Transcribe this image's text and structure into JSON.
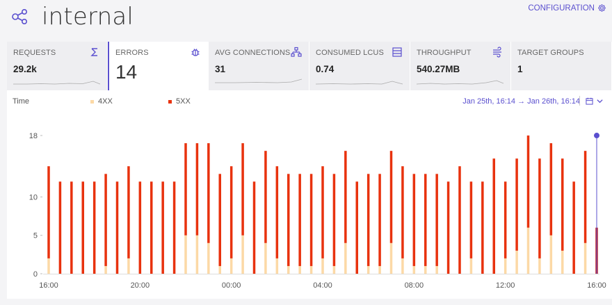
{
  "header": {
    "title": "internal",
    "config_label": "CONFIGURATION"
  },
  "tabs": [
    {
      "label": "REQUESTS",
      "value": "29.2k",
      "icon": "sigma-icon"
    },
    {
      "label": "ERRORS",
      "value": "14",
      "icon": "bug-icon",
      "active": true
    },
    {
      "label": "AVG CONNECTIONS",
      "value": "31",
      "icon": "network-icon"
    },
    {
      "label": "CONSUMED LCUS",
      "value": "0.74",
      "icon": "server-icon"
    },
    {
      "label": "THROUGHPUT",
      "value": "540.27MB",
      "icon": "stream-icon"
    },
    {
      "label": "TARGET GROUPS",
      "value": "1"
    }
  ],
  "panel": {
    "time_label": "Time",
    "legend": [
      {
        "name": "4XX",
        "color": "#fcd9a6"
      },
      {
        "name": "5XX",
        "color": "#e8320e"
      }
    ],
    "date_range": "Jan 25th, 16:14 → Jan 26th, 16:14"
  },
  "colors": {
    "accent": "#5a4fcf",
    "series_4xx": "#fcd9a6",
    "series_5xx": "#e8320e"
  },
  "chart_data": {
    "type": "bar",
    "stacked": true,
    "x_tick_labels": [
      "16:00",
      "20:00",
      "00:00",
      "04:00",
      "08:00",
      "12:00",
      "16:00"
    ],
    "y_ticks": [
      0,
      5,
      10,
      18
    ],
    "ylim": [
      0,
      19
    ],
    "grid": false,
    "legend_position": "top-left",
    "x_hours": [
      16.0,
      16.5,
      17.0,
      17.5,
      18.0,
      18.5,
      19.0,
      19.5,
      20.0,
      20.5,
      21.0,
      21.5,
      22.0,
      22.5,
      23.0,
      23.5,
      24.0,
      24.5,
      25.0,
      25.5,
      26.0,
      26.5,
      27.0,
      27.5,
      28.0,
      28.5,
      29.0,
      29.5,
      30.0,
      30.5,
      31.0,
      31.5,
      32.0,
      32.5,
      33.0,
      33.5,
      34.0,
      34.5,
      35.0,
      35.5,
      36.0,
      36.5,
      37.0,
      37.5,
      38.0,
      38.5,
      39.0,
      39.5,
      40.0
    ],
    "series": [
      {
        "name": "4XX",
        "values": [
          2,
          0,
          0,
          0,
          0,
          1,
          0,
          2,
          0,
          0,
          0,
          0,
          5,
          5,
          4,
          1,
          2,
          5,
          0,
          4,
          2,
          1,
          1,
          1,
          2,
          1,
          4,
          0,
          1,
          1,
          4,
          2,
          1,
          1,
          1,
          0,
          0,
          2,
          0,
          0,
          2,
          3,
          6,
          2,
          5,
          3,
          0,
          4,
          0
        ]
      },
      {
        "name": "5XX",
        "values": [
          12,
          12,
          12,
          12,
          12,
          12,
          12,
          12,
          12,
          12,
          12,
          12,
          12,
          12,
          13,
          12,
          12,
          12,
          12,
          12,
          12,
          12,
          12,
          12,
          12,
          12,
          12,
          12,
          12,
          12,
          12,
          12,
          12,
          12,
          12,
          12,
          14,
          10,
          12,
          15,
          10,
          12,
          12,
          13,
          12,
          12,
          12,
          12,
          6
        ]
      }
    ],
    "hover_x_hours": 40.0,
    "hover_value": 18
  }
}
